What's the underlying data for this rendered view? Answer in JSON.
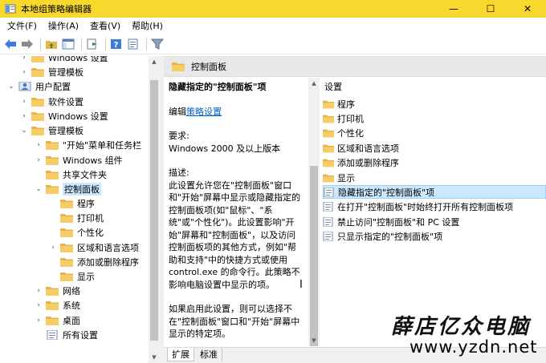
{
  "window": {
    "title": "本地组策略编辑器",
    "buttons": {
      "minimize": "—",
      "maximize": "☐",
      "close": "✕"
    }
  },
  "menu": [
    "文件(F)",
    "操作(A)",
    "查看(V)",
    "帮助(H)"
  ],
  "toolbar": {
    "icons": [
      "back-arrow-icon",
      "forward-arrow-icon",
      "up-folder-icon",
      "show-hide-tree-icon",
      "export-list-icon",
      "help-icon",
      "properties-icon",
      "filter-icon"
    ]
  },
  "tree": {
    "items": [
      {
        "label": "Windows 设置",
        "depth": 2,
        "arrow": "›"
      },
      {
        "label": "管理模板",
        "depth": 2,
        "arrow": "›"
      },
      {
        "label": "用户配置",
        "depth": 1,
        "arrow": "⌄",
        "icon": "user-icon"
      },
      {
        "label": "软件设置",
        "depth": 2,
        "arrow": "›"
      },
      {
        "label": "Windows 设置",
        "depth": 2,
        "arrow": "›"
      },
      {
        "label": "管理模板",
        "depth": 2,
        "arrow": "⌄"
      },
      {
        "label": "\"开始\"菜单和任务栏",
        "depth": 3,
        "arrow": "›"
      },
      {
        "label": "Windows 组件",
        "depth": 3,
        "arrow": "›"
      },
      {
        "label": "共享文件夹",
        "depth": 3,
        "arrow": ""
      },
      {
        "label": "控制面板",
        "depth": 3,
        "arrow": "⌄",
        "selected": true
      },
      {
        "label": "程序",
        "depth": 4,
        "arrow": ""
      },
      {
        "label": "打印机",
        "depth": 4,
        "arrow": ""
      },
      {
        "label": "个性化",
        "depth": 4,
        "arrow": ""
      },
      {
        "label": "区域和语言选项",
        "depth": 4,
        "arrow": "›"
      },
      {
        "label": "添加或删除程序",
        "depth": 4,
        "arrow": ""
      },
      {
        "label": "显示",
        "depth": 4,
        "arrow": ""
      },
      {
        "label": "网络",
        "depth": 3,
        "arrow": "›"
      },
      {
        "label": "系统",
        "depth": 3,
        "arrow": "›"
      },
      {
        "label": "桌面",
        "depth": 3,
        "arrow": "›"
      },
      {
        "label": "所有设置",
        "depth": 3,
        "arrow": "",
        "icon": "settings-list-icon"
      }
    ]
  },
  "right": {
    "header": "控制面板",
    "description": {
      "heading": "隐藏指定的\"控制面板\"项",
      "edit_prefix": "编辑",
      "edit_link": "策略设置",
      "requirements_label": "要求:",
      "requirements": "Windows 2000 及以上版本",
      "desc_label": "描述:",
      "desc_text": "此设置允许您在\"控制面板\"窗口和\"开始\"屏幕中显示或隐藏指定的控制面板项(如\"鼠标\"、\"系统\"或\"个性化\")。此设置影响\"开始\"屏幕和\"控制面板\"，以及访问控制面板项的其他方式，例如\"帮助和支持\"中的快捷方式或使用 control.exe 的命令行。此策略不影响电脑设置中显示的项。",
      "if_text": "如果启用此设置，则可以选择不在\"控制面板\"窗口和\"开始\"屏幕中显示的特定项。"
    },
    "list": {
      "column": "设置",
      "folders": [
        "程序",
        "打印机",
        "个性化",
        "区域和语言选项",
        "添加或删除程序",
        "显示"
      ],
      "policies": [
        {
          "label": "隐藏指定的\"控制面板\"项",
          "selected": true
        },
        {
          "label": "在打开\"控制面板\"时始终打开所有控制面板项"
        },
        {
          "label": "禁止访问\"控制面板\"和 PC 设置"
        },
        {
          "label": "只显示指定的\"控制面板\"项"
        }
      ]
    },
    "tabs": [
      "扩展",
      "标准"
    ]
  },
  "watermark": {
    "text": "薛店亿众电脑",
    "url": "www.yzdn.net"
  },
  "colors": {
    "titlebar": "#f7d92d",
    "selection": "#cce8ff",
    "folder": "#e8b44a",
    "link": "#0066cc"
  }
}
